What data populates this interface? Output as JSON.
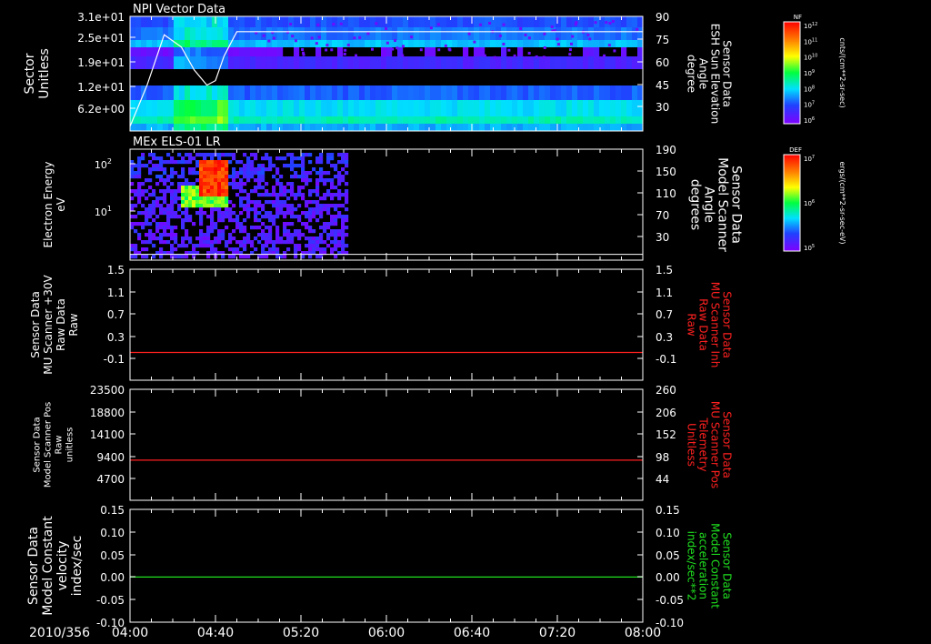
{
  "date_label": "2010/356",
  "time_ticks": [
    "04:00",
    "04:40",
    "05:20",
    "06:00",
    "06:40",
    "07:20",
    "08:00"
  ],
  "colors": {
    "white": "#ffffff",
    "red": "#ff2020",
    "green": "#20e020",
    "frame": "#ffffff"
  },
  "chart_data": [
    {
      "type": "heatmap",
      "title": "NPI Vector Data",
      "ylabel": [
        "Sector",
        "Unitless"
      ],
      "yticks": [
        "3.1e+01",
        "2.5e+01",
        "1.9e+01",
        "1.2e+01",
        "6.2e+00"
      ],
      "right_label": [
        "Sensor Data",
        "ESH Sun Elevation",
        "Angle",
        "degree"
      ],
      "right_ticks": [
        "90",
        "75",
        "60",
        "45",
        "30"
      ],
      "right_ylim": [
        15,
        90
      ],
      "overlay_series": {
        "name": "ESH Sun Elevation Angle",
        "x": [
          "04:00",
          "04:08",
          "04:16",
          "04:24",
          "04:30",
          "04:36",
          "04:40",
          "04:44",
          "04:50",
          "04:56",
          "05:00",
          "08:00"
        ],
        "values": [
          18,
          45,
          78,
          70,
          55,
          45,
          48,
          64,
          80,
          80,
          80,
          80
        ]
      },
      "colorbar": {
        "label": "NF",
        "units": "cnts/(cm**2-sr-sec)",
        "ticks": [
          "10^12",
          "10^11",
          "10^10",
          "10^9",
          "10^8",
          "10^7",
          "10^6"
        ]
      }
    },
    {
      "type": "heatmap",
      "title": "MEx ELS-01 LR",
      "ylabel": [
        "Electron Energy",
        "eV"
      ],
      "yticks": [
        "10^2",
        "10^1"
      ],
      "right_label": [
        "Sensor Data",
        "Model Scanner",
        "Angle",
        "degrees"
      ],
      "right_ticks": [
        "190",
        "150",
        "110",
        "70",
        "30"
      ],
      "right_ylim": [
        0,
        190
      ],
      "overlay_series": {
        "name": "Model Scanner Angle",
        "x": [
          "04:00",
          "08:00"
        ],
        "values": [
          10,
          10
        ]
      },
      "data_extent": {
        "start": "04:00",
        "end": "05:42"
      },
      "colorbar": {
        "label": "DEF",
        "units": "ergs/(cm**2-sr-sec-eV)",
        "ticks": [
          "10^7",
          "10^6",
          "10^5"
        ]
      }
    },
    {
      "type": "line",
      "ylabel": [
        "Sensor Data",
        "MU Scanner +30V",
        "Raw Data",
        "Raw"
      ],
      "yticks": [
        "1.5",
        "1.1",
        "0.7",
        "0.3",
        "-0.1"
      ],
      "ylim": [
        -0.5,
        1.5
      ],
      "right_label": [
        "Sensor Data",
        "MU Scanner Inh",
        "Raw Data",
        "Raw"
      ],
      "right_ticks": [
        "1.5",
        "1.1",
        "0.7",
        "0.3",
        "-0.1"
      ],
      "series": [
        {
          "name": "MU Scanner Inh",
          "color": "red",
          "x": [
            "04:00",
            "08:00"
          ],
          "values": [
            0,
            0
          ]
        }
      ]
    },
    {
      "type": "line",
      "ylabel": [
        "Sensor Data",
        "Model Scanner Pos",
        "Raw",
        "unitless"
      ],
      "yticks": [
        "23500",
        "18800",
        "14100",
        "9400",
        "4700"
      ],
      "ylim": [
        0,
        23500
      ],
      "right_label": [
        "Sensor Data",
        "MU Scanner Pos",
        "Telemetry",
        "Unitless"
      ],
      "right_ticks": [
        "260",
        "206",
        "152",
        "98",
        "44"
      ],
      "series": [
        {
          "name": "MU Scanner Pos Telemetry",
          "color": "red",
          "x": [
            "04:00",
            "08:00"
          ],
          "values": [
            8500,
            8500
          ]
        }
      ]
    },
    {
      "type": "line",
      "ylabel": [
        "Sensor Data",
        "Model Constant",
        "velocity",
        "index/sec"
      ],
      "yticks": [
        "0.15",
        "0.10",
        "0.05",
        "0.00",
        "-0.05",
        "-0.10"
      ],
      "ylim": [
        -0.1,
        0.15
      ],
      "right_label": [
        "Sensor Data",
        "Model Constant",
        "acceleration",
        "index/sec**2"
      ],
      "right_ticks": [
        "0.15",
        "0.10",
        "0.05",
        "0.00",
        "-0.05",
        "-0.10"
      ],
      "series": [
        {
          "name": "Model Constant acceleration",
          "color": "green",
          "x": [
            "04:00",
            "08:00"
          ],
          "values": [
            0,
            0
          ]
        }
      ]
    }
  ]
}
